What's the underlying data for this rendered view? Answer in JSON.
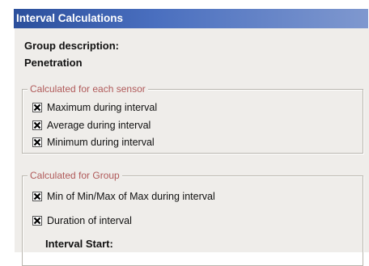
{
  "window": {
    "title": "Interval Calculations"
  },
  "group": {
    "description_label": "Group description:",
    "description_value": "Penetration"
  },
  "sensor_group": {
    "legend": "Calculated for each sensor",
    "items": [
      {
        "label": "Maximum during interval",
        "checked": true
      },
      {
        "label": "Average during interval",
        "checked": true
      },
      {
        "label": "Minimum during interval",
        "checked": true
      }
    ]
  },
  "group_calc": {
    "legend": "Calculated for Group",
    "items": [
      {
        "label": "Min of Min/Max of Max during interval",
        "checked": true
      },
      {
        "label": "Duration of interval",
        "checked": true
      }
    ],
    "interval_start_label": "Interval Start:"
  },
  "colors": {
    "title_bar_start": "#2b4f9c",
    "title_bar_end": "#7f98cf",
    "legend_text": "#b05a5a",
    "panel_bg": "#efedea"
  }
}
